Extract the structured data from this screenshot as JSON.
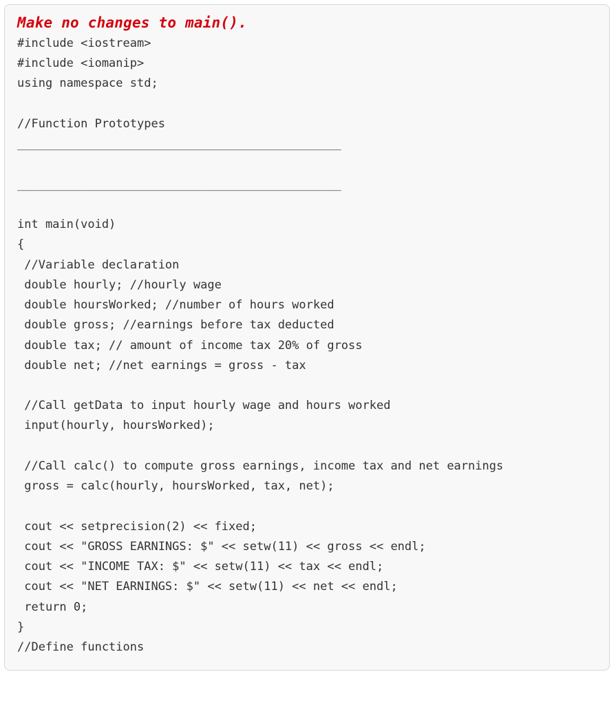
{
  "warning": "Make no changes to main().",
  "code": "#include <iostream>\n#include <iomanip>\nusing namespace std;\n\n//Function Prototypes\n______________________________________________\n\n______________________________________________\n\nint main(void)\n{\n //Variable declaration\n double hourly; //hourly wage\n double hoursWorked; //number of hours worked\n double gross; //earnings before tax deducted\n double tax; // amount of income tax 20% of gross\n double net; //net earnings = gross - tax\n\n //Call getData to input hourly wage and hours worked\n input(hourly, hoursWorked);\n\n //Call calc() to compute gross earnings, income tax and net earnings\n gross = calc(hourly, hoursWorked, tax, net);\n\n cout << setprecision(2) << fixed;\n cout << \"GROSS EARNINGS: $\" << setw(11) << gross << endl;\n cout << \"INCOME TAX: $\" << setw(11) << tax << endl;\n cout << \"NET EARNINGS: $\" << setw(11) << net << endl;\n return 0;\n}\n//Define functions"
}
